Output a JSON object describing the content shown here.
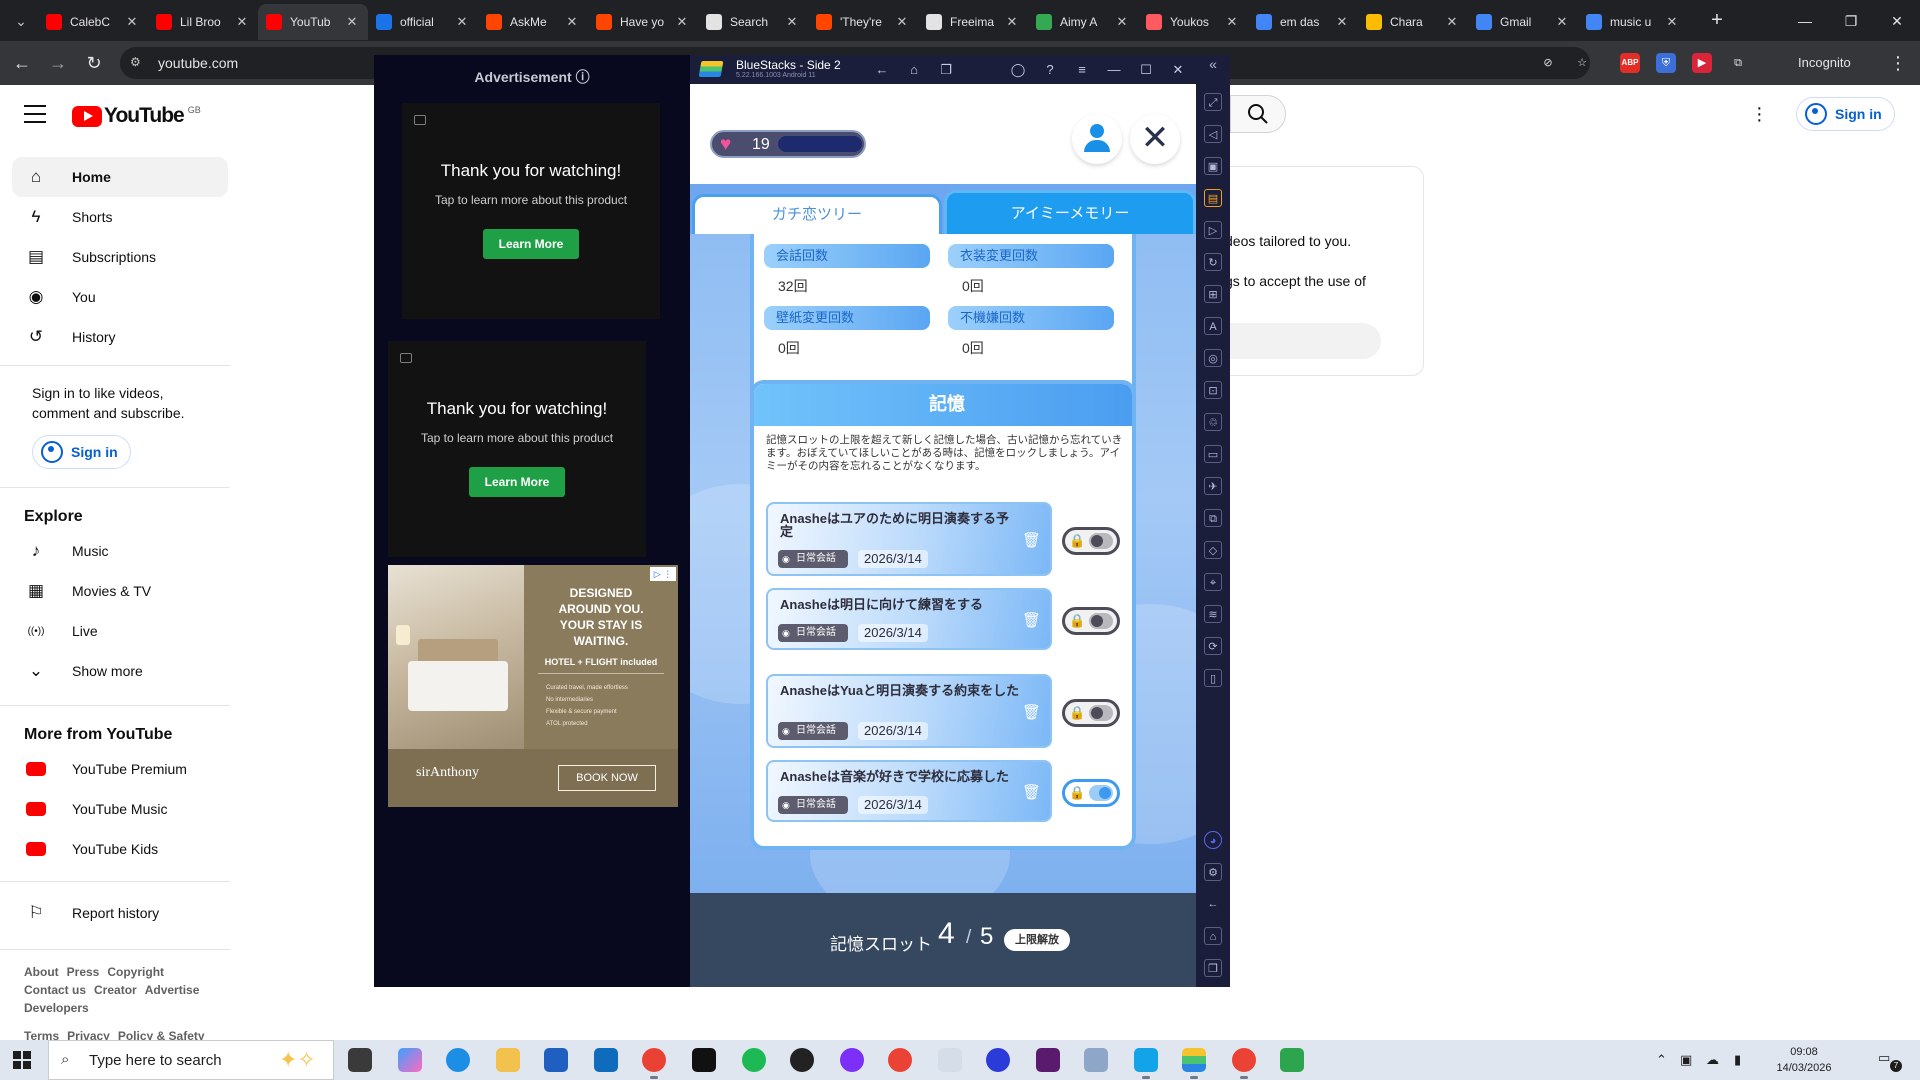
{
  "browser": {
    "tabs": [
      {
        "title": "CalebC",
        "color": "#ff0000"
      },
      {
        "title": "Lil Broo",
        "color": "#ff0000"
      },
      {
        "title": "YouTub",
        "color": "#ff0000",
        "active": true
      },
      {
        "title": "official",
        "color": "#1a73e8"
      },
      {
        "title": "AskMe",
        "color": "#ff4500"
      },
      {
        "title": "Have yo",
        "color": "#ff4500"
      },
      {
        "title": "Search",
        "color": "#e3e3e3"
      },
      {
        "title": "'They're",
        "color": "#ff4500"
      },
      {
        "title": "Freeima",
        "color": "#e3e3e3"
      },
      {
        "title": "Aimy A",
        "color": "#34a853"
      },
      {
        "title": "Youkos",
        "color": "#ff5a5f"
      },
      {
        "title": "em das",
        "color": "#4285f4"
      },
      {
        "title": "Chara",
        "color": "#fbbc04"
      },
      {
        "title": "Gmail",
        "color": "#4285f4"
      },
      {
        "title": "music u",
        "color": "#4285f4"
      }
    ],
    "url": "youtube.com",
    "incognito_label": "Incognito"
  },
  "youtube": {
    "logo_text": "YouTube",
    "region": "GB",
    "sign_in": "Sign in",
    "nav": [
      {
        "label": "Home",
        "icon": "home-icon",
        "glyph": "⌂"
      },
      {
        "label": "Shorts",
        "icon": "shorts-icon",
        "glyph": "ϟ"
      },
      {
        "label": "Subscriptions",
        "icon": "subscriptions-icon",
        "glyph": "▤"
      },
      {
        "label": "You",
        "icon": "you-icon",
        "glyph": "◉"
      },
      {
        "label": "History",
        "icon": "history-icon",
        "glyph": "↺"
      }
    ],
    "sign_in_prompt": "Sign in to like videos, comment and subscribe.",
    "explore_title": "Explore",
    "explore": [
      {
        "label": "Music",
        "icon": "music-note-icon",
        "glyph": "♪"
      },
      {
        "label": "Movies & TV",
        "icon": "movies-icon",
        "glyph": "▦"
      },
      {
        "label": "Live",
        "icon": "live-icon",
        "glyph": "((•))"
      },
      {
        "label": "Show more",
        "icon": "chevron-down-icon",
        "glyph": "⌄"
      }
    ],
    "more_title": "More from YouTube",
    "more": [
      {
        "label": "YouTube Premium"
      },
      {
        "label": "YouTube Music"
      },
      {
        "label": "YouTube Kids"
      }
    ],
    "report_history": "Report history",
    "footer_line1": [
      "About",
      "Press",
      "Copyright"
    ],
    "footer_line2": [
      "Contact us",
      "Creator",
      "Advertise"
    ],
    "footer_line3": [
      "Developers"
    ],
    "footer_line4": [
      "Terms",
      "Privacy",
      "Policy & Safety"
    ],
    "card_text1": "deos tailored to you.",
    "card_text2": "gs to accept the use of"
  },
  "ad": {
    "label": "Advertisement ⓘ",
    "box1": {
      "title": "Thank you for watching!",
      "sub": "Tap to learn more about this product",
      "button": "Learn More"
    },
    "box2": {
      "title": "Thank you for watching!",
      "sub": "Tap to learn more about this product",
      "button": "Learn More"
    },
    "hotel": {
      "headline_l1": "DESIGNED",
      "headline_l2": "AROUND YOU.",
      "headline_l3": "YOUR STAY IS",
      "headline_l4": "WAITING.",
      "package": "HOTEL + FLIGHT included",
      "bullets": [
        "Curated travel, made effortless",
        "No intermediaries",
        "Flexible & secure payment",
        "ATOL protected"
      ],
      "brand": "sirAnthony",
      "cta": "BOOK NOW"
    }
  },
  "bluestacks": {
    "title": "BlueStacks - Side 2",
    "version": "5.22.166.1003 Android 11"
  },
  "game": {
    "hearts": "19",
    "tabs": [
      "ガチ恋ツリー",
      "アイミーメモリー"
    ],
    "stats": [
      {
        "label": "会話回数",
        "value": "32回"
      },
      {
        "label": "衣装変更回数",
        "value": "0回"
      },
      {
        "label": "壁紙変更回数",
        "value": "0回"
      },
      {
        "label": "不機嫌回数",
        "value": "0回"
      }
    ],
    "memory_title": "記憶",
    "memory_desc": "記憶スロットの上限を超えて新しく記憶した場合、古い記憶から忘れていきます。おぼえていてほしいことがある時は、記憶をロックしましょう。アイミーがその内容を忘れることがなくなります。",
    "memories": [
      {
        "text": "Anasheはユアのために明日演奏する予定",
        "tag": "日常会話",
        "date": "2026/3/14",
        "locked": false
      },
      {
        "text": "Anasheは明日に向けて練習をする",
        "tag": "日常会話",
        "date": "2026/3/14",
        "locked": false
      },
      {
        "text": "AnasheはYuaと明日演奏する約束をした",
        "tag": "日常会話",
        "date": "2026/3/14",
        "locked": false
      },
      {
        "text": "Anasheは音楽が好きで学校に応募した",
        "tag": "日常会話",
        "date": "2026/3/14",
        "locked": true
      }
    ],
    "slot_label": "記憶スロット",
    "slot_used": "4",
    "slot_sep": "/",
    "slot_max": "5",
    "unlock_label": "上限解放"
  },
  "taskbar": {
    "search_placeholder": "Type here to search",
    "time": "09:08",
    "date": "14/03/2026",
    "notifications": "7"
  }
}
